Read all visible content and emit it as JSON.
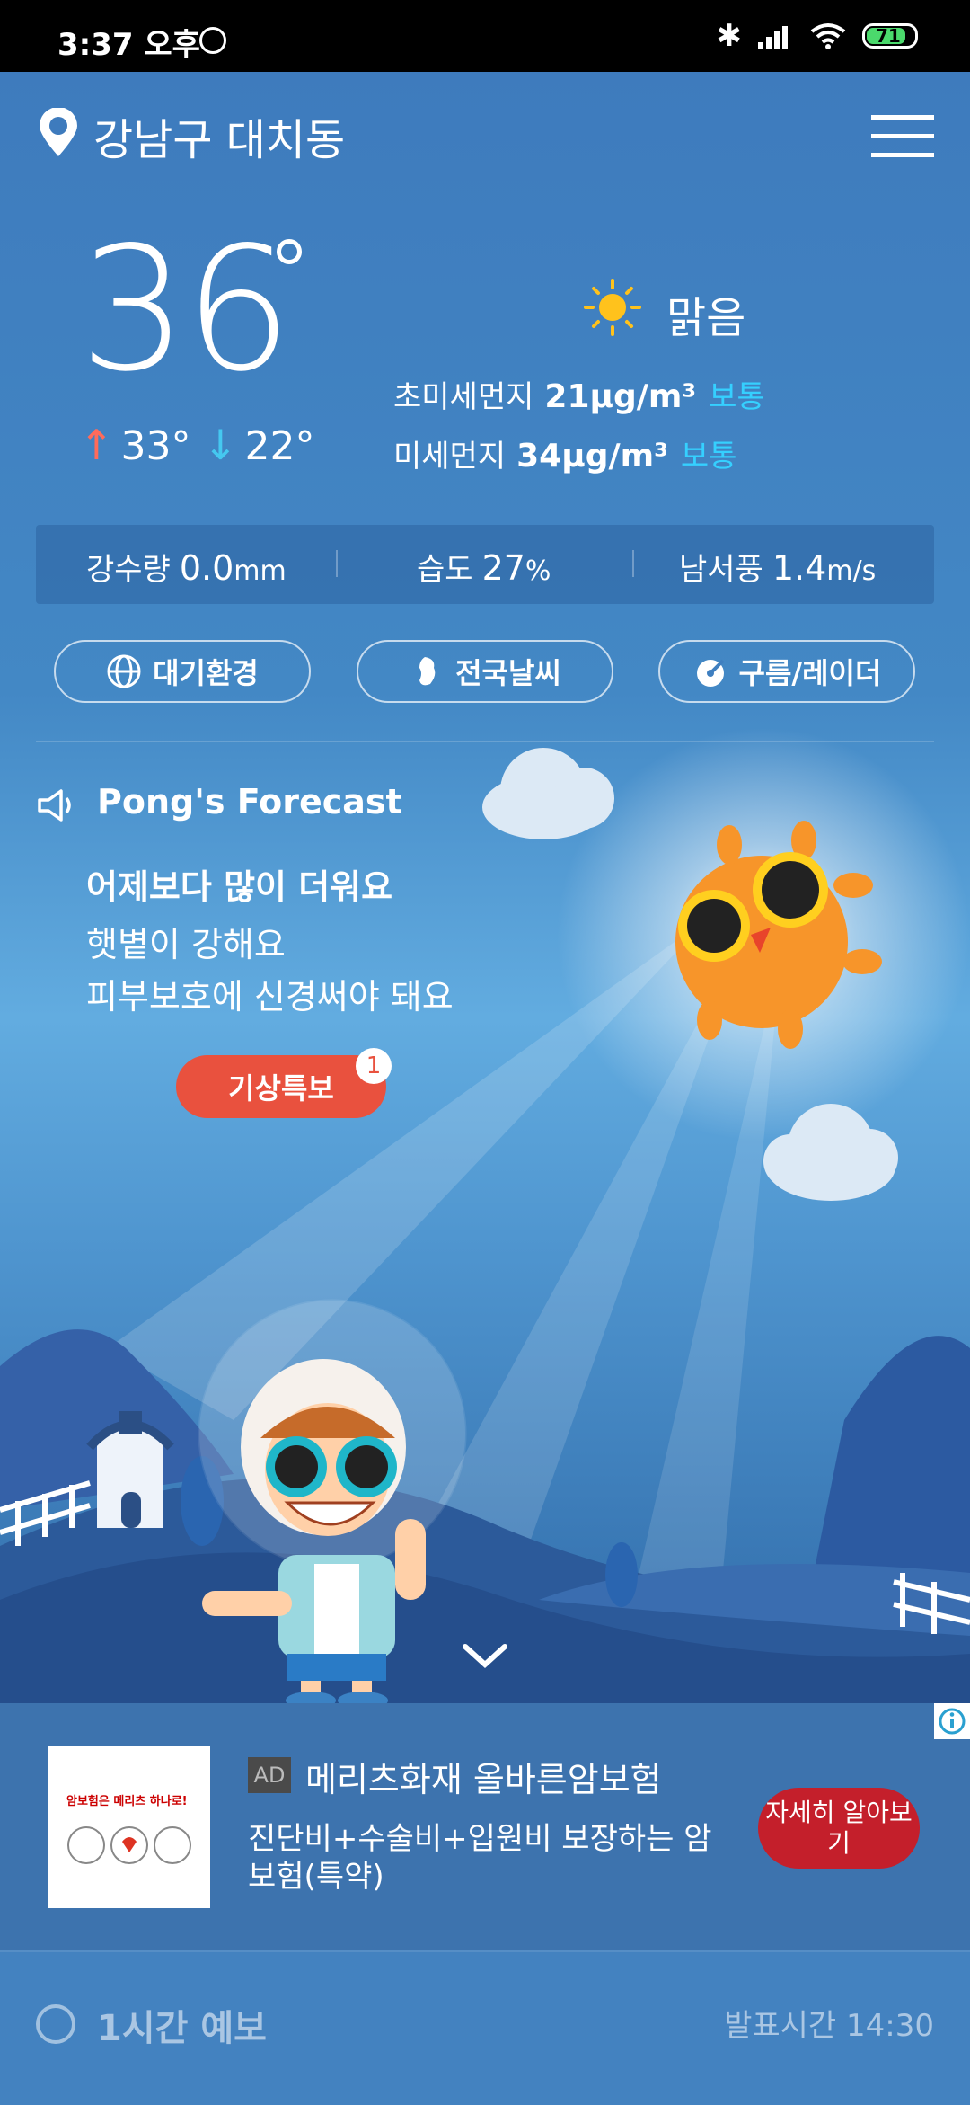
{
  "status_bar": {
    "time": "3:37 오후",
    "battery": "71"
  },
  "header": {
    "location": "강남구 대치동"
  },
  "current": {
    "temp": "36",
    "high": "33°",
    "low": "22°",
    "condition": "맑음",
    "fine_dust_label": "초미세먼지",
    "fine_dust_value": "21μg/m³",
    "fine_dust_status": "보통",
    "dust_label": "미세먼지",
    "dust_value": "34μg/m³",
    "dust_status": "보통"
  },
  "stats": {
    "rain_label": "강수량",
    "rain_value": "0.0",
    "rain_unit": "mm",
    "humidity_label": "습도",
    "humidity_value": "27",
    "humidity_unit": "%",
    "wind_label": "남서풍",
    "wind_value": "1.4",
    "wind_unit": "m/s"
  },
  "buttons": {
    "air": "대기환경",
    "national": "전국날씨",
    "radar": "구름/레이더"
  },
  "forecast": {
    "title": "Pong's Forecast",
    "line1": "어제보다 많이 더워요",
    "line2": "햇볕이 강해요",
    "line3": "피부보호에 신경써야 돼요",
    "warning_label": "기상특보",
    "warning_count": "1"
  },
  "ad": {
    "tag": "AD",
    "title": "메리츠화재 올바른암보험",
    "desc": "진단비+수술비+입원비 보장하는 암보험(특약)",
    "cta": "자세히 알아보기",
    "img_title": "암보험은 메리츠 하나로!"
  },
  "hourly": {
    "title": "1시간 예보",
    "published": "발표시간 14:30"
  },
  "colors": {
    "accent_blue": "#35d0ff",
    "warning_red": "#e9513e",
    "cta_red": "#c41f2b"
  }
}
